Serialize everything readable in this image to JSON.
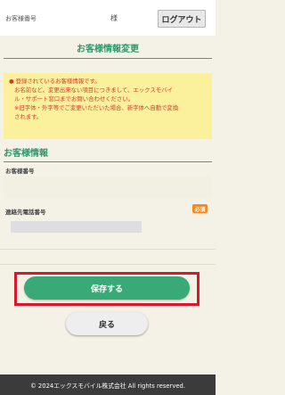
{
  "header": {
    "member_number_label": "お客様番号",
    "honorific": "様",
    "logout_label": "ログアウト"
  },
  "page_title": "お客様情報変更",
  "notice": {
    "lines": [
      "● 登録されているお客様情報です。",
      "お名前など、変更出来ない項目につきまして、エックスモバイ",
      "ル・サポート窓口までお問い合わせください。",
      "※旧字体・外字等でご変更いただいた場合、新字体へ自動で変換",
      "されます。"
    ]
  },
  "customer_info": {
    "section_title": "お客様情報",
    "member_number_label": "お客様番号",
    "contact_phone_label": "連絡先電話番号",
    "required_badge": "必須",
    "contact_phone_value": ""
  },
  "actions": {
    "save_label": "保存する",
    "back_label": "戻る"
  },
  "footer": {
    "copyright": "© 2024エックスモバイル株式会社 All rights reserved."
  },
  "colors": {
    "brand_green": "#3aa978",
    "highlight_red": "#d9182d",
    "notice_bg": "#fbf19c",
    "notice_text": "#d33a2a",
    "required_orange": "#f08a24"
  }
}
